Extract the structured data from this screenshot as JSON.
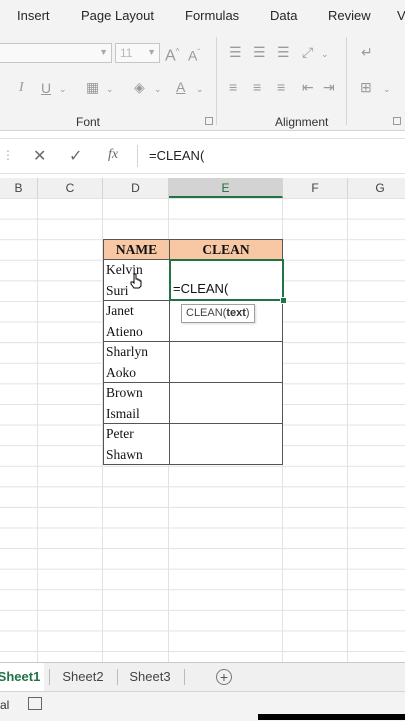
{
  "ribbon": {
    "tabs": [
      "Insert",
      "Page Layout",
      "Formulas",
      "Data",
      "Review",
      "V"
    ],
    "font_name": "",
    "font_size": "11",
    "group_font": "Font",
    "group_alignment": "Alignment"
  },
  "formula_bar": {
    "content": "=CLEAN(",
    "fx": "fx"
  },
  "columns": [
    "B",
    "C",
    "D",
    "E",
    "F",
    "G"
  ],
  "selected_column": "E",
  "table": {
    "headers": [
      "NAME",
      "CLEAN"
    ],
    "rows": [
      {
        "name_line1": "Kelvin",
        "name_line2": "Suri",
        "clean": "=CLEAN("
      },
      {
        "name_line1": "Janet",
        "name_line2": "Atieno",
        "clean": ""
      },
      {
        "name_line1": "Sharlyn",
        "name_line2": "Aoko",
        "clean": ""
      },
      {
        "name_line1": "Brown",
        "name_line2": "Ismail",
        "clean": ""
      },
      {
        "name_line1": "Peter",
        "name_line2": "Shawn",
        "clean": ""
      }
    ]
  },
  "tooltip": {
    "fn": "CLEAN(",
    "arg": "text",
    "close": ")"
  },
  "sheets": [
    "Sheet1",
    "Sheet2",
    "Sheet3"
  ],
  "active_sheet": "Sheet1",
  "status": {
    "mode": "al"
  },
  "colors": {
    "accent": "#217346",
    "header_fill": "#f7c8a3"
  }
}
